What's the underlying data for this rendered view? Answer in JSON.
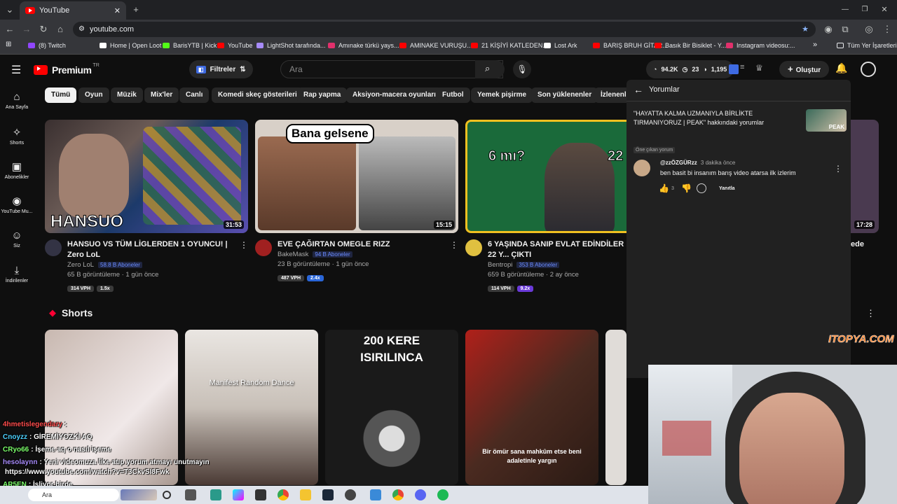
{
  "browser": {
    "tab_title": "YouTube",
    "url": "youtube.com",
    "bookmarks": [
      {
        "label": "(8) Twitch",
        "color": "#9146ff"
      },
      {
        "label": "Home | Open Loot",
        "color": "#ffffff"
      },
      {
        "label": "BarisYTB | Kick",
        "color": "#53fc18"
      },
      {
        "label": "YouTube",
        "color": "#ff0000"
      },
      {
        "label": "LightShot tarafında...",
        "color": "#a78bfa"
      },
      {
        "label": "Amınake türkü yays...",
        "color": "#e1306c"
      },
      {
        "label": "AMINAKE VURUŞU...",
        "color": "#ff0000"
      },
      {
        "label": "21 KİŞİYİ KATLEDEN...",
        "color": "#ff0000"
      },
      {
        "label": "Lost Ark",
        "color": "#ffffff"
      },
      {
        "label": "BARIŞ BRUH GİTAR...",
        "color": "#ff0000"
      },
      {
        "label": "Basık Bir Bisiklet - Y...",
        "color": "#ff0000"
      },
      {
        "label": "Instagram videosu:...",
        "color": "#e1306c"
      }
    ],
    "all_bookmarks": "Tüm Yer İşaretleri"
  },
  "yt": {
    "logo": "Premium",
    "logo_sup": "TR",
    "filter_label": "Filtreler",
    "search_placeholder": "Ara",
    "stats": {
      "views": "94.2K",
      "count": "23",
      "subs": "1,195"
    },
    "create_label": "Oluştur",
    "chips": [
      "Tümü",
      "Oyun",
      "Müzik",
      "Mix'ler",
      "Canlı",
      "Komedi skeç gösterileri",
      "Rap yapma",
      "Aksiyon-macera oyunları",
      "Futbol",
      "Yemek pişirme",
      "Son yüklenenler",
      "İzlenenler"
    ],
    "sidebar": [
      {
        "label": "Ana Sayfa",
        "icon": "⌂"
      },
      {
        "label": "Shorts",
        "icon": "✧"
      },
      {
        "label": "Abonelikler",
        "icon": "▣"
      },
      {
        "label": "YouTube Mu...",
        "icon": "◉"
      },
      {
        "label": "Siz",
        "icon": "☺"
      },
      {
        "label": "İndirilenler",
        "icon": "⤓"
      }
    ],
    "videos": [
      {
        "title": "HANSUO VS TÜM LİGLERDEN 1 OYUNCU! | Zero LoL",
        "channel": "Zero LoL",
        "subs": "58.8 B Aboneler",
        "meta": "65 B görüntüleme · 1 gün önce",
        "vph": "314 VPH",
        "ratio": "1.5x",
        "duration": "31:53",
        "thumb_text": "HANSUO"
      },
      {
        "title": "EVE ÇAĞIRTAN OMEGLE RIZZ",
        "channel": "BakeMask",
        "subs": "94 B Aboneler",
        "meta": "23 B görüntüleme · 1 gün önce",
        "vph": "487 VPH",
        "ratio": "2.4x",
        "duration": "15:15",
        "thumb_text": "Bana gelsene"
      },
      {
        "title": "6 YAŞINDA SANIP EVLAT EDİNDİLER 22 Y... ÇIKTI",
        "channel": "Bentropi",
        "subs": "353 B Aboneler",
        "meta": "659 B görüntüleme · 2 ay önce",
        "vph": "114 VPH",
        "ratio": "9.2x",
        "duration": "",
        "thumb_text": "6 mı?"
      }
    ],
    "fourth_duration": "17:28",
    "fourth_title_tail": "ede",
    "shorts_title": "Shorts",
    "shorts": [
      {
        "caption": ""
      },
      {
        "caption": "Manifest Random Dance"
      },
      {
        "caption": "200 KERE ISIRILINCA"
      },
      {
        "caption": "Bir ömür sana mahkûm etse beni adaletinle yargın"
      }
    ]
  },
  "comments": {
    "header": "Yorumlar",
    "video_title": "\"HAYATTA KALMA UZMANIYLA BİRLİKTE TIRMANIYORUZ | PEAK\" hakkındaki yorumlar",
    "highlight": "Öne çıkan yorum",
    "author": "@zzÖZGÜRzz",
    "time": "3 dakika önce",
    "text": "ben basit bi insanım barış video atarsa ilk izlerim",
    "likes": "3",
    "reply": "Yanıtla"
  },
  "watermark": "ITOPYA.COM",
  "chat": [
    {
      "user": "4hmetislegendary",
      "msg": ":",
      "color": "#ff4d4d"
    },
    {
      "user": "Cnoyzz",
      "msg": ": GİREMİYOZKİ AQ",
      "color": "#4dd2ff"
    },
    {
      "user": "CRyo66",
      "msg": ": İşeme aq o nasıl işeme",
      "color": "#7cff6b"
    },
    {
      "user": "hesolaynn",
      "msg": ": Yeni videomuza like atıp yorum atmayı unutmayın",
      "color": "#a78bfa"
    },
    {
      "user": "",
      "msg": "https://www.youtube.com/watch?v=T3CkvSI8Fwk",
      "color": "#ffffff"
    },
    {
      "user": "AR5EN",
      "msg": ": İşliyor birde",
      "color": "#7cff6b"
    }
  ],
  "taskbar": {
    "search": "Ara"
  }
}
